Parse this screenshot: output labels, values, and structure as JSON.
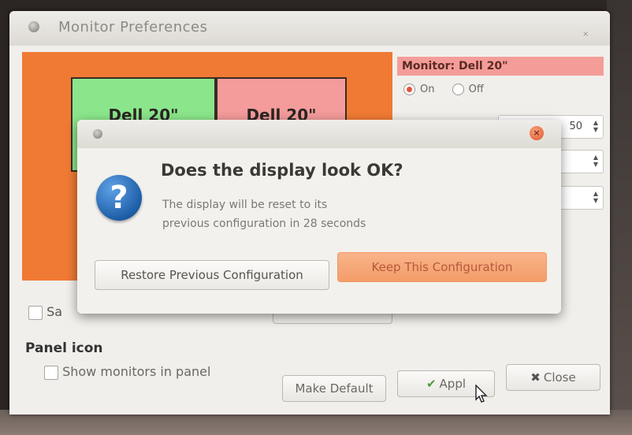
{
  "window": {
    "title": "Monitor Preferences",
    "close_glyph": "×"
  },
  "layout": {
    "monitors": [
      {
        "label": "Dell 20\"",
        "color": "#8be68b"
      },
      {
        "label": "Dell 20\"",
        "color": "#f49b9b"
      }
    ],
    "canvas_color": "#f07a33"
  },
  "panel": {
    "monitor_header": "Monitor: Dell 20\"",
    "on_label": "On",
    "off_label": "Off",
    "selected": "On",
    "refresh_partial": "50"
  },
  "same_image_label": "Sa",
  "panel_icon": {
    "title": "Panel icon",
    "show_label": "Show monitors in panel"
  },
  "buttons": {
    "make_default": "Make Default",
    "apply": "Appl",
    "close": "Close"
  },
  "dialog": {
    "close_glyph": "×",
    "heading": "Does the display look OK?",
    "body_line1": "The display will be reset to its",
    "body_line2": "previous configuration in 28 seconds",
    "restore_button": "Restore Previous Configuration",
    "keep_button": "Keep This Configuration",
    "icon_glyph": "?"
  },
  "colors": {
    "accent_orange": "#f39c68",
    "header_pink": "#f49d98",
    "question_blue": "#1d5ea8"
  }
}
